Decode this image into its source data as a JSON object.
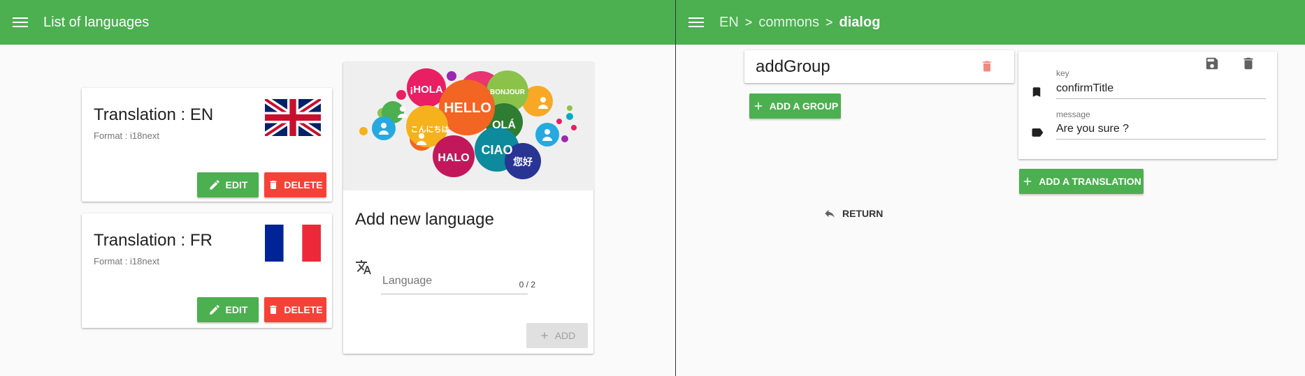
{
  "left": {
    "toolbar": {
      "title": "List of languages",
      "menu_icon": "menu-icon"
    },
    "languages": [
      {
        "title": "Translation : EN",
        "format": "Format : i18next",
        "flag": "uk-flag",
        "edit_label": "EDIT",
        "delete_label": "DELETE"
      },
      {
        "title": "Translation : FR",
        "format": "Format : i18next",
        "flag": "france-flag",
        "edit_label": "EDIT",
        "delete_label": "DELETE"
      }
    ],
    "add_card": {
      "title": "Add new language",
      "input_placeholder": "Language",
      "input_value": "",
      "counter": "0 / 2",
      "add_label": "ADD",
      "image_words": [
        "¡HOLA",
        "HELLO",
        "BONJOUR",
        "OLÁ",
        "こんにちは",
        "CIAO",
        "HALO",
        "您好"
      ]
    }
  },
  "right": {
    "toolbar": {
      "crumbs": [
        "EN",
        "commons",
        "dialog"
      ],
      "separator": ">"
    },
    "group": {
      "title": "addGroup",
      "add_group_label": "ADD A GROUP"
    },
    "translation": {
      "key_label": "key",
      "key_value": "confirmTitle",
      "message_label": "message",
      "message_value": "Are you sure ?",
      "add_translation_label": "ADD A TRANSLATION"
    },
    "return_label": "RETURN"
  },
  "colors": {
    "primary": "#4caf50",
    "danger": "#f44336",
    "background": "#fafafa"
  }
}
